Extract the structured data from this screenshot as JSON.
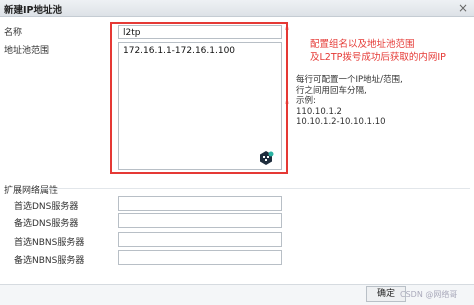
{
  "dialog": {
    "title": "新建IP地址池",
    "close_glyph": "×",
    "name_label": "名称",
    "name_value": "l2tp",
    "range_label": "地址池范围",
    "range_value": "172.16.1.1-172.16.1.100",
    "required_mark": "*",
    "annotation": [
      "配置组名以及地址池范围",
      "及L2TP拨号成功后获取的内网IP"
    ],
    "hint": [
      "每行可配置一个IP地址/范围,",
      "行之间用回车分隔,",
      "示例:",
      "110.10.1.2",
      "10.10.1.2-10.10.1.10"
    ],
    "ext_title": "扩展网络属性",
    "ext_fields": [
      {
        "label": "首选DNS服务器",
        "value": ""
      },
      {
        "label": "备选DNS服务器",
        "value": ""
      },
      {
        "label": "首选NBNS服务器",
        "value": ""
      },
      {
        "label": "备选NBNS服务器",
        "value": ""
      }
    ],
    "ok_label": "确定",
    "watermark": "CSDN @网络哥",
    "accent_color": "#e53935"
  }
}
